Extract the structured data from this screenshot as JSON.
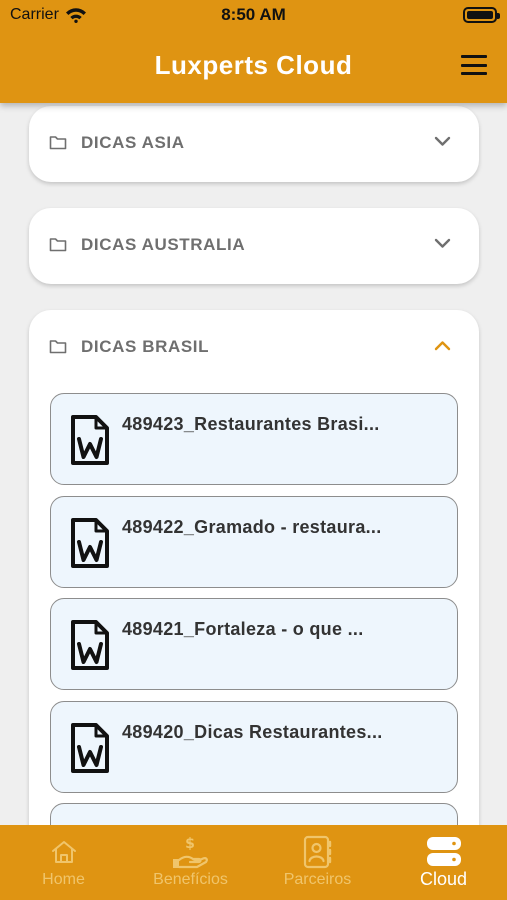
{
  "status_bar": {
    "carrier": "Carrier",
    "time": "8:50 AM"
  },
  "header": {
    "title": "Luxperts Cloud"
  },
  "folders": [
    {
      "label": "DICAS ASIA",
      "expanded": false,
      "chevron": "chevron-down-icon"
    },
    {
      "label": "DICAS AUSTRALIA",
      "expanded": false,
      "chevron": "chevron-down-icon"
    },
    {
      "label": "DICAS BRASIL",
      "expanded": true,
      "chevron": "chevron-up-icon"
    }
  ],
  "files": [
    {
      "name": "489423_Restaurantes Brasi...",
      "icon": "word-document-icon"
    },
    {
      "name": "489422_Gramado - restaura...",
      "icon": "word-document-icon"
    },
    {
      "name": "489421_Fortaleza - o que ...",
      "icon": "word-document-icon"
    },
    {
      "name": "489420_Dicas Restaurantes...",
      "icon": "word-document-icon"
    }
  ],
  "tabs": [
    {
      "label": "Home",
      "icon": "home-icon",
      "active": false
    },
    {
      "label": "Benefícios",
      "icon": "hand-dollar-icon",
      "active": false
    },
    {
      "label": "Parceiros",
      "icon": "contacts-icon",
      "active": false
    },
    {
      "label": "Cloud",
      "icon": "server-icon",
      "active": true
    }
  ],
  "colors": {
    "brand": "#df9412",
    "tab_inactive": "#f0c56b",
    "file_background": "#eef6fd",
    "folder_text": "#6f6f6f"
  }
}
